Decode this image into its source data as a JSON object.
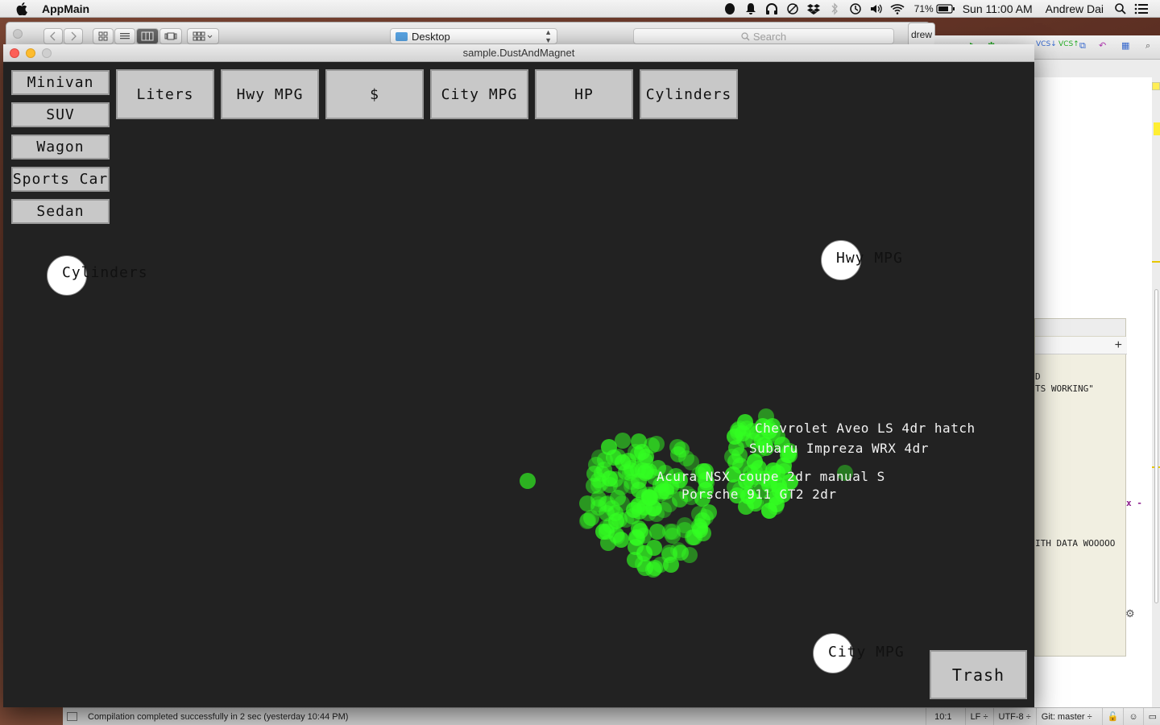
{
  "menubar": {
    "app_name": "AppMain",
    "battery_pct": "71%",
    "clock": "Sun 11:00 AM",
    "user": "Andrew Dai",
    "icons": [
      "apple-icon",
      "evernote-icon",
      "notification-icon",
      "headphones-icon",
      "sync-icon",
      "dropbox-icon",
      "bluetooth-icon",
      "time-machine-icon",
      "volume-icon",
      "wifi-icon",
      "battery-icon",
      "spotlight-icon",
      "notification-center-icon"
    ]
  },
  "finder": {
    "location": "Desktop",
    "search_placeholder": "Search",
    "tab_edge_label": "drew"
  },
  "ide": {
    "code_lines": [
      "D",
      "TS WORKING\"",
      "x -",
      "ITH DATA WOOOOO"
    ],
    "panel_plus": "+"
  },
  "statusbar": {
    "message": "Compilation completed successfully in 2 sec (yesterday 10:44 PM)",
    "position": "10:1",
    "line_ending": "LF ÷",
    "encoding": "UTF-8 ÷",
    "vcs": "Git: master ÷"
  },
  "window": {
    "title": "sample.DustAndMagnet"
  },
  "categories": [
    "Minivan",
    "SUV",
    "Wagon",
    "Sports Car",
    "Sedan"
  ],
  "attributes": [
    "Liters",
    "Hwy MPG",
    "$",
    "City MPG",
    "HP",
    "Cylinders"
  ],
  "magnets": [
    {
      "label": "Cylinders"
    },
    {
      "label": "Hwy MPG"
    },
    {
      "label": "City MPG"
    }
  ],
  "dust_labels": [
    "Chevrolet Aveo LS 4dr hatch",
    "Subaru Impreza WRX 4dr",
    "Acura NSX coupe 2dr manual S",
    "Porsche 911 GT2 2dr"
  ],
  "dust_color": "#33ff22",
  "trash_label": "Trash"
}
